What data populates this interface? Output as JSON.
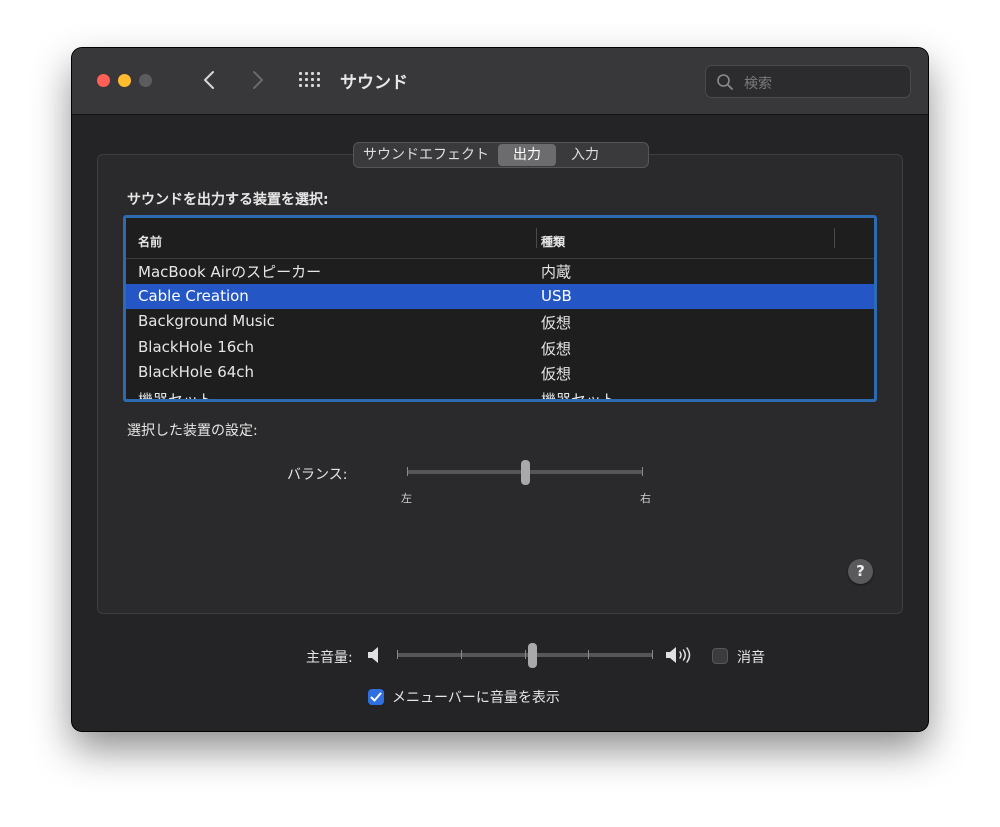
{
  "window": {
    "title": "サウンド"
  },
  "search": {
    "placeholder": "検索"
  },
  "tabs": [
    {
      "label": "サウンドエフェクト",
      "selected": false
    },
    {
      "label": "出力",
      "selected": true
    },
    {
      "label": "入力",
      "selected": false
    }
  ],
  "output": {
    "select_label": "サウンドを出力する装置を選択:",
    "columns": {
      "name": "名前",
      "type": "種類"
    },
    "devices": [
      {
        "name": "MacBook Airのスピーカー",
        "type": "内蔵",
        "selected": false
      },
      {
        "name": "Cable Creation",
        "type": "USB",
        "selected": true
      },
      {
        "name": "Background Music",
        "type": "仮想",
        "selected": false
      },
      {
        "name": "BlackHole 16ch",
        "type": "仮想",
        "selected": false
      },
      {
        "name": "BlackHole 64ch",
        "type": "仮想",
        "selected": false
      },
      {
        "name": "機器セット",
        "type": "機器セット",
        "selected": false
      }
    ],
    "settings_label": "選択した装置の設定:",
    "balance": {
      "label": "バランス:",
      "left_label": "左",
      "right_label": "右",
      "value": 0.5
    }
  },
  "help": {
    "label": "?"
  },
  "volume": {
    "label": "主音量:",
    "value": 0.53
  },
  "mute": {
    "label": "消音",
    "checked": false
  },
  "menubar_option": {
    "label": "メニューバーに音量を表示",
    "checked": true
  },
  "colors": {
    "accent": "#2d6ab0",
    "selection": "#2556c5",
    "checkbox": "#2f6fe0"
  }
}
